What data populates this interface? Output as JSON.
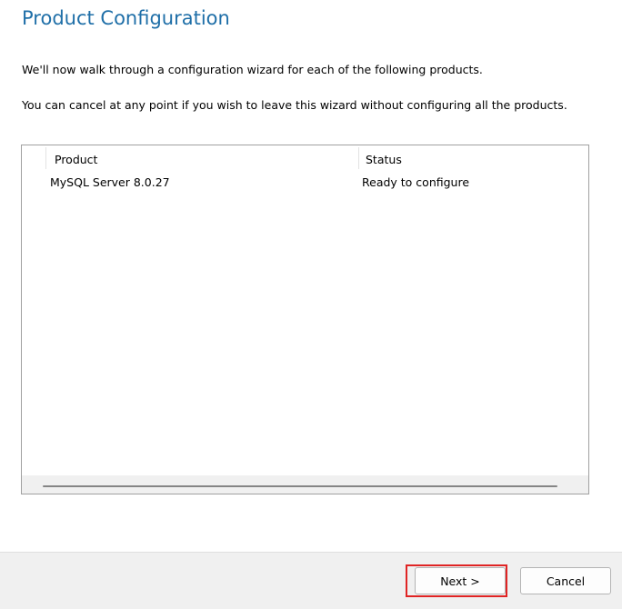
{
  "page": {
    "title": "Product Configuration",
    "intro": "We'll now walk through a configuration wizard for each of the following products.",
    "cancel_note": "You can cancel at any point if you wish to leave this wizard without configuring all the products."
  },
  "table": {
    "columns": [
      "Product",
      "Status"
    ],
    "rows": [
      {
        "product": "MySQL Server 8.0.27",
        "status": "Ready to configure"
      }
    ]
  },
  "buttons": {
    "next": "Next >",
    "cancel": "Cancel"
  },
  "colors": {
    "title": "#1f6fa8",
    "highlight": "#e02424"
  }
}
